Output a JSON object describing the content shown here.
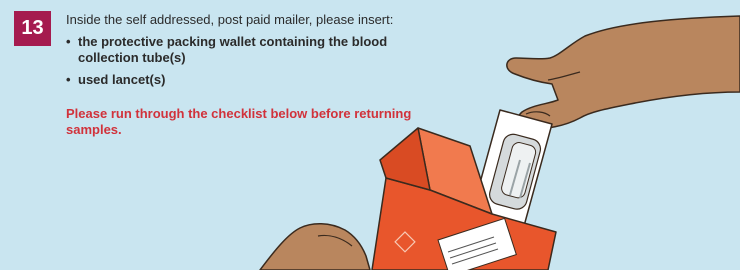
{
  "step": {
    "number": "13"
  },
  "instructions": {
    "intro": "Inside the self addressed, post paid mailer, please insert:",
    "items": [
      "the protective packing wallet containing the blood collection tube(s)",
      "used lancet(s)"
    ],
    "bullet": "•",
    "note": "Please run through the checklist below before returning samples."
  },
  "colors": {
    "background": "#c9e5f0",
    "badge": "#a51b4f",
    "note": "#d1323b",
    "mailer": "#e8562c",
    "skin": "#b9865e"
  },
  "illustration": {
    "objects": [
      "hand-holding-packing-wallet",
      "orange-mailer-box",
      "hand-holding-mailer"
    ]
  }
}
